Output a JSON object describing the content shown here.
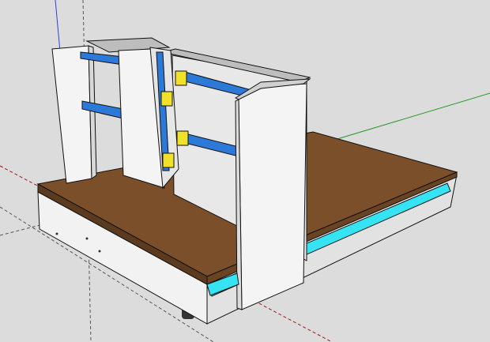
{
  "app": {
    "viewport_label": "",
    "background_color": "#dcdcdc"
  },
  "axes": {
    "red": "#d02020",
    "green": "#2a9a2a",
    "blue": "#2f3fd0",
    "guide": "#444444"
  },
  "model": {
    "parts": [
      "base-top-board",
      "base-front-skirt",
      "base-left-skirt",
      "left-gantry-plate",
      "right-gantry-plate",
      "gantry-back-plate",
      "z-axis-carriage",
      "x-axis-rails",
      "z-axis-rails",
      "linear-bearing-blocks",
      "y-axis-rails",
      "leveling-feet"
    ],
    "colors": {
      "wood": "#7a4f2a",
      "wood_edge": "#5c3a1e",
      "panel": "#f2f2f2",
      "panel_shade": "#e2e2e2",
      "rail_blue": "#2c79d8",
      "rail_cyan": "#35e3f2",
      "bearing_yellow": "#f2e12a",
      "foot": "#333333",
      "outline": "#111111"
    }
  }
}
